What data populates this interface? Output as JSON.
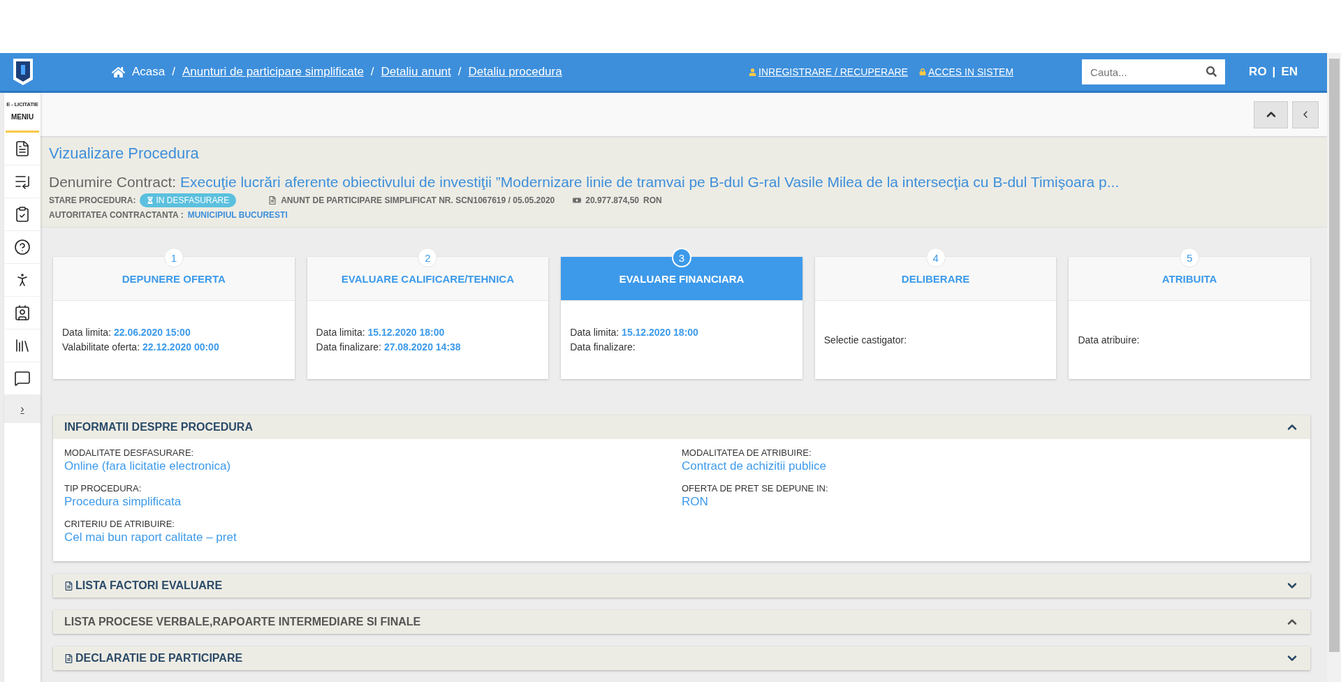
{
  "nav": {
    "breadcrumbs": [
      {
        "label": "Acasa",
        "link": false
      },
      {
        "label": "Anunturi de participare simplificate",
        "link": true
      },
      {
        "label": "Detaliu anunt",
        "link": true
      },
      {
        "label": "Detaliu procedura",
        "link": true
      }
    ],
    "separator": "/",
    "register": "INREGISTRARE / RECUPERARE",
    "login": "ACCES IN SISTEM",
    "search": {
      "placeholder": "Cauta..."
    },
    "languages": [
      "RO",
      "EN"
    ],
    "language_separator": "|"
  },
  "sidebar": {
    "brand": "E - LICITATIE",
    "menu": "MENIU",
    "expand": "›"
  },
  "header": {
    "title": "Vizualizare Procedura",
    "contract_label": "Denumire Contract:",
    "contract_name": "Execuţie lucrări aferente obiectivului de investiţii ”Modernizare linie de tramvai pe B-dul G-ral Vasile Milea de la intersecţia cu B-dul Timişoara p...",
    "status_label": "STARE PROCEDURA:",
    "status": "IN DESFASURARE",
    "notice": "ANUNT DE PARTICIPARE SIMPLIFICAT NR. SCN1067619 / 05.05.2020",
    "value": "20.977.874,50",
    "currency": "RON",
    "authority_label": "AUTORITATEA CONTRACTANTA :",
    "authority": "MUNICIPIUL BUCURESTI"
  },
  "steps": [
    {
      "number": "1",
      "title": "DEPUNERE OFERTA",
      "selected": false,
      "lines": [
        {
          "label": "Data limita:",
          "value": "22.06.2020 15:00"
        },
        {
          "label": "Valabilitate oferta:",
          "value": "22.12.2020 00:00"
        }
      ]
    },
    {
      "number": "2",
      "title": "EVALUARE CALIFICARE/TEHNICA",
      "selected": false,
      "lines": [
        {
          "label": "Data limita:",
          "value": "15.12.2020 18:00"
        },
        {
          "label": "Data finalizare:",
          "value": "27.08.2020 14:38"
        }
      ]
    },
    {
      "number": "3",
      "title": "EVALUARE FINANCIARA",
      "selected": true,
      "lines": [
        {
          "label": "Data limita:",
          "value": "15.12.2020 18:00"
        },
        {
          "label": "Data finalizare:"
        }
      ]
    },
    {
      "number": "4",
      "title": "DELIBERARE",
      "selected": false,
      "lines": [
        {
          "label": "Selectie castigator:"
        }
      ]
    },
    {
      "number": "5",
      "title": "ATRIBUITA",
      "selected": false,
      "lines": [
        {
          "label": "Data atribuire:"
        }
      ]
    }
  ],
  "sections": [
    {
      "title": "INFORMATII DESPRE PROCEDURA",
      "expanded": true,
      "document_icon": false,
      "muted": false,
      "fields": [
        {
          "label": "MODALITATE DESFASURARE:",
          "value": "Online (fara licitatie electronica)"
        },
        {
          "label": "MODALITATEA DE ATRIBUIRE:",
          "value": "Contract de achizitii publice"
        },
        {
          "label": "TIP PROCEDURA:",
          "value": "Procedura simplificata"
        },
        {
          "label": "OFERTA DE PRET SE DEPUNE IN:",
          "value": "RON"
        },
        {
          "label": "CRITERIU DE ATRIBUIRE:",
          "value": "Cel mai bun raport calitate – pret"
        }
      ]
    },
    {
      "title": "LISTA FACTORI EVALUARE",
      "expanded": false,
      "document_icon": true,
      "muted": false
    },
    {
      "title": "LISTA PROCESE VERBALE,RAPOARTE INTERMEDIARE SI FINALE",
      "expanded": true,
      "document_icon": false,
      "muted": true
    },
    {
      "title": "DECLARATIE DE PARTICIPARE",
      "expanded": false,
      "document_icon": true,
      "muted": false
    }
  ]
}
